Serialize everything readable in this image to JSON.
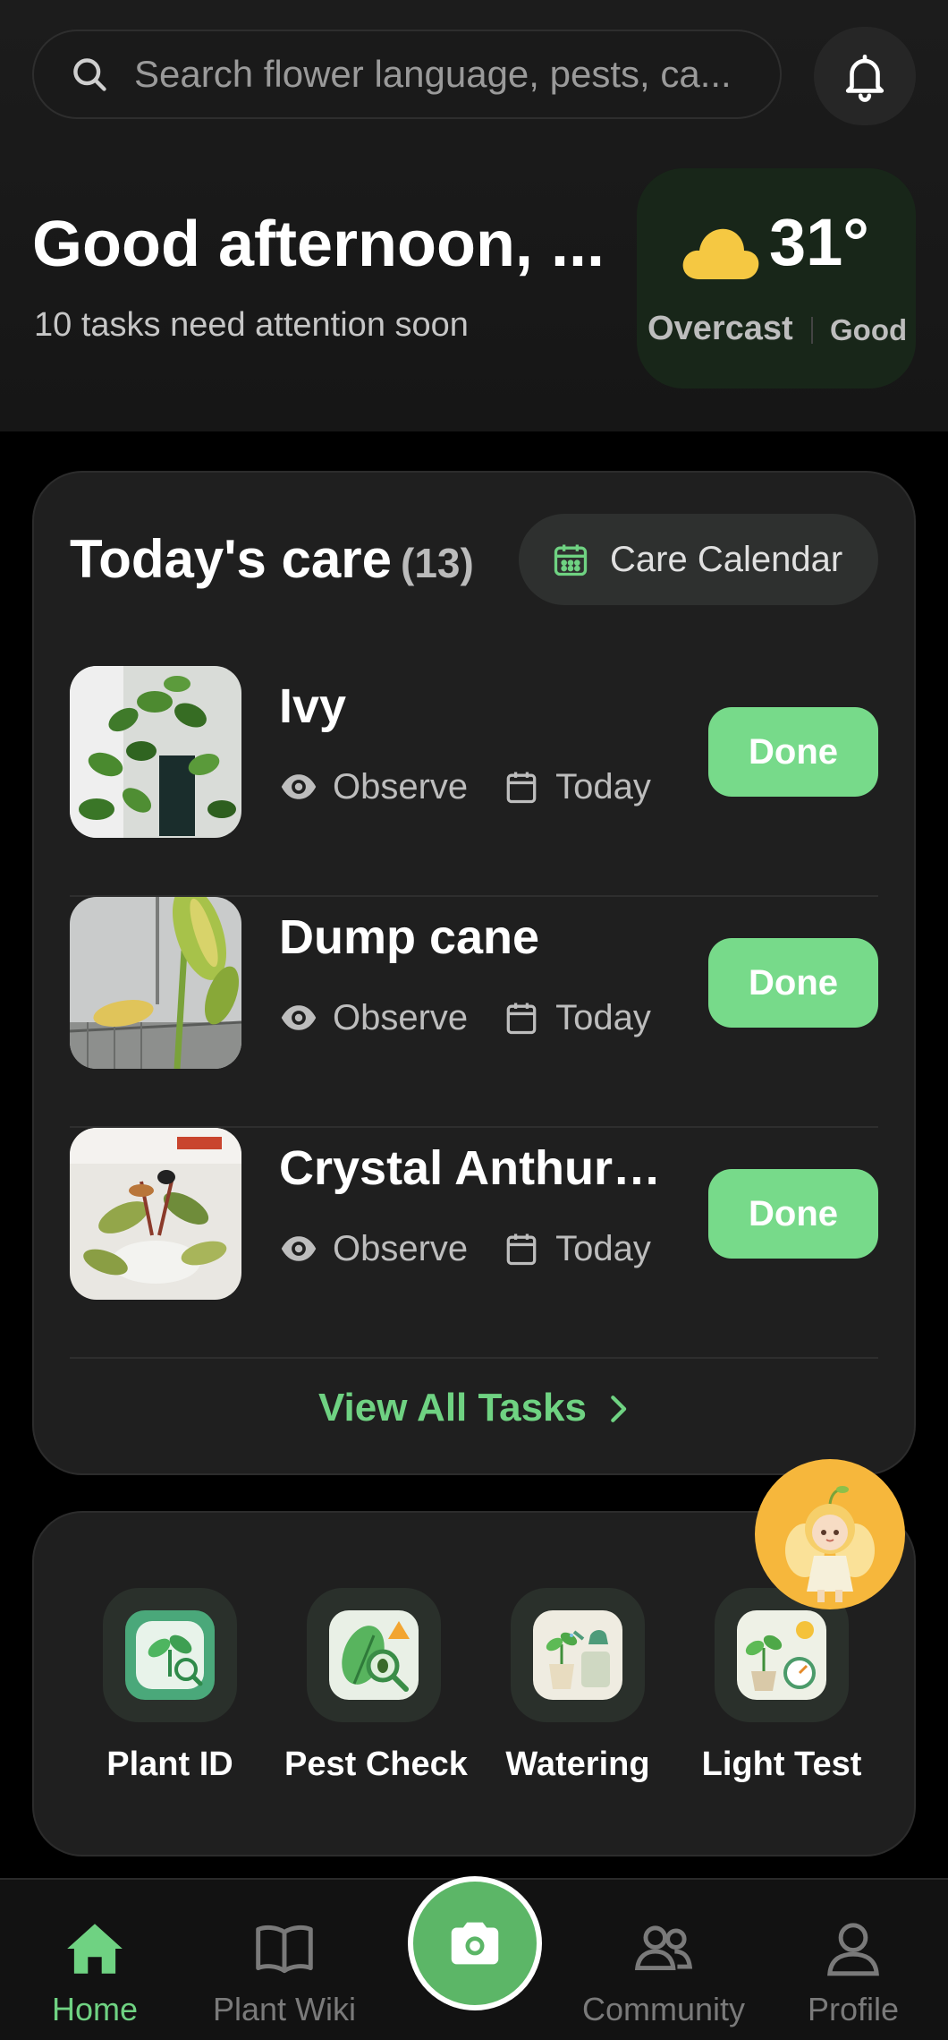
{
  "search": {
    "placeholder": "Search flower language, pests, ca..."
  },
  "header": {
    "greeting": "Good afternoon, ...",
    "subtitle": "10 tasks need attention soon"
  },
  "weather": {
    "temperature": "31°",
    "condition": "Overcast",
    "air_quality": "Good",
    "icon": "cloud-icon",
    "icon_color": "#f5c842"
  },
  "care": {
    "title": "Today's care",
    "count": "(13)",
    "calendar_label": "Care Calendar",
    "tasks": [
      {
        "name": "Ivy",
        "action": "Observe",
        "due": "Today",
        "button": "Done"
      },
      {
        "name": "Dump cane",
        "action": "Observe",
        "due": "Today",
        "button": "Done"
      },
      {
        "name": "Crystal Anthuriu...",
        "action": "Observe",
        "due": "Today",
        "button": "Done"
      }
    ],
    "view_all": "View All Tasks"
  },
  "tools": [
    {
      "label": "Plant ID",
      "icon": "plant-id-icon"
    },
    {
      "label": "Pest Check",
      "icon": "pest-check-icon"
    },
    {
      "label": "Watering",
      "icon": "watering-icon"
    },
    {
      "label": "Light Test",
      "icon": "light-test-icon"
    }
  ],
  "nav": {
    "home": "Home",
    "wiki": "Plant Wiki",
    "community": "Community",
    "profile": "Profile"
  },
  "colors": {
    "accent": "#6fd282",
    "done_button": "#77da8a",
    "camera": "#5cb667",
    "fairy_bg": "#f6b73c"
  }
}
